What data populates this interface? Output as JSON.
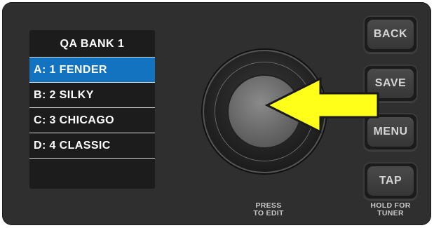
{
  "display": {
    "title": "QA BANK 1",
    "presets": [
      {
        "label": "A: 1 FENDER",
        "selected": true
      },
      {
        "label": "B: 2 SILKY",
        "selected": false
      },
      {
        "label": "C: 3 CHICAGO",
        "selected": false
      },
      {
        "label": "D: 4 CLASSIC",
        "selected": false
      }
    ]
  },
  "buttons": {
    "back": "BACK",
    "save": "SAVE",
    "menu": "MENU",
    "tap": "TAP"
  },
  "knob": {
    "caption_line1": "PRESS",
    "caption_line2": "TO EDIT"
  },
  "tap_caption": {
    "line1": "HOLD FOR",
    "line2": "TUNER"
  },
  "colors": {
    "selected_row": "#1473c0",
    "arrow": "#ffff1a",
    "panel": "#2f2f2f"
  },
  "icons": {
    "arrow": "arrow-left-pointer-icon"
  }
}
